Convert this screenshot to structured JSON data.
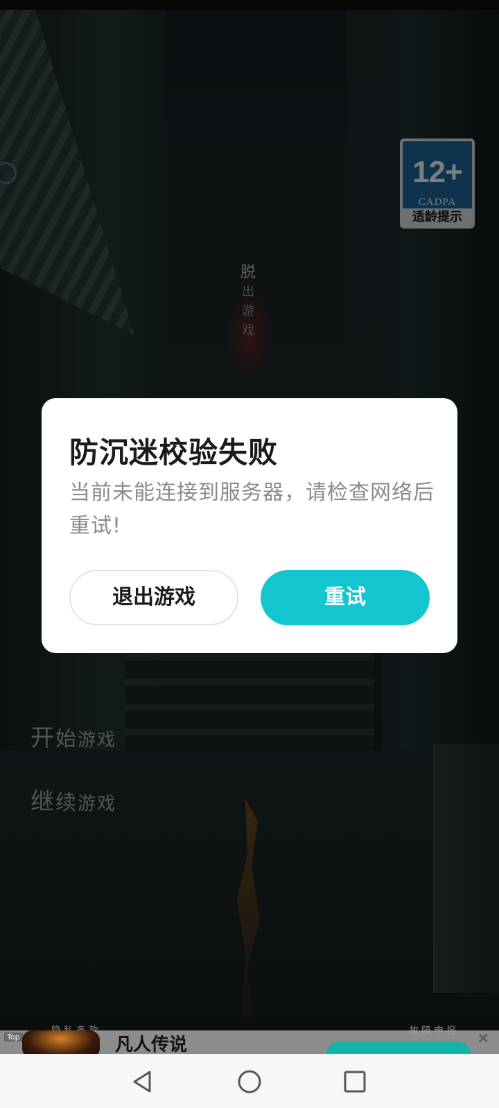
{
  "game": {
    "vertical_title": [
      "脱",
      "出",
      "游",
      "戏"
    ],
    "menu": {
      "start_big": "开",
      "start_rest": "始",
      "start_tail": "游戏",
      "continue_big": "继",
      "continue_rest": "续",
      "continue_tail": "游戏"
    },
    "captions": {
      "left": "隐私条款",
      "right": "故障申报"
    }
  },
  "age_badge": {
    "age": "12+",
    "org": "CADPA",
    "tip": "适龄提示"
  },
  "dialog": {
    "title": "防沉迷校验失败",
    "message": "当前未能连接到服务器，请检查网络后重试!",
    "exit_label": "退出游戏",
    "retry_label": "重试",
    "accent_color": "#13C5CF"
  },
  "ad": {
    "tag": "Top",
    "title": "凡人传说",
    "close_icon": "close-icon"
  },
  "navbar": {
    "back_icon": "back-triangle-icon",
    "home_icon": "home-circle-icon",
    "recents_icon": "recents-square-icon"
  }
}
